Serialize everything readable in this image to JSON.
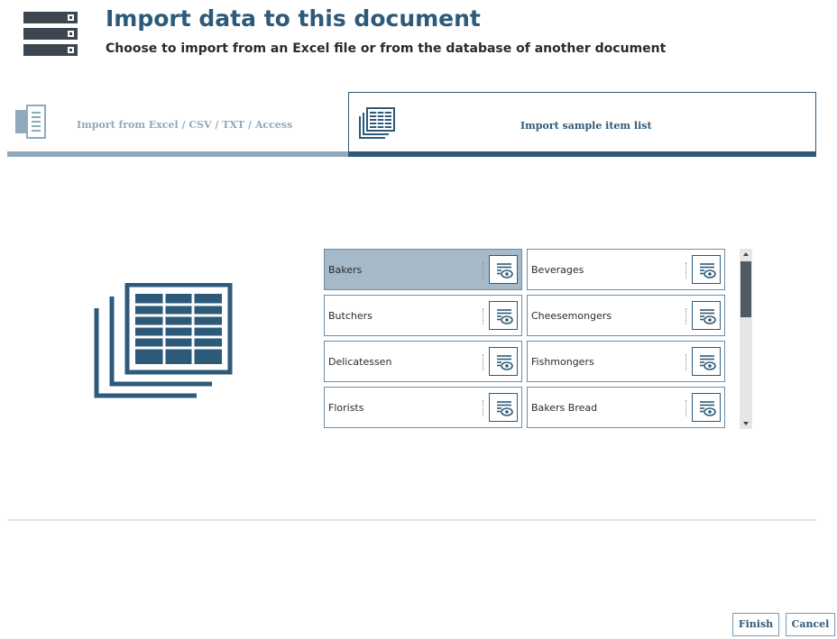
{
  "header": {
    "icon": "server-stack-icon",
    "title": "Import data to this document",
    "subtitle": "Choose to import from an Excel file or from the database of another document"
  },
  "tabs": [
    {
      "label": "Import from Excel / CSV / TXT / Access",
      "icon": "excel-file-icon",
      "active": false
    },
    {
      "label": "Import sample item list",
      "icon": "table-stack-icon",
      "active": true
    }
  ],
  "illustration": {
    "icon": "table-stack-icon"
  },
  "list": {
    "items": [
      {
        "label": "Bakers",
        "selected": true
      },
      {
        "label": "Beverages",
        "selected": false
      },
      {
        "label": "Butchers",
        "selected": false
      },
      {
        "label": "Cheesemongers",
        "selected": false
      },
      {
        "label": "Delicatessen",
        "selected": false
      },
      {
        "label": "Fishmongers",
        "selected": false
      },
      {
        "label": "Florists",
        "selected": false
      },
      {
        "label": "Bakers Bread",
        "selected": false
      }
    ],
    "preview_icon": "preview-eye-icon"
  },
  "buttons": {
    "finish": "Finish",
    "cancel": "Cancel"
  },
  "colors": {
    "accent": "#2e5a7a",
    "inactive_tab": "#8fa9bd",
    "selected_item": "#a6b9c8"
  }
}
